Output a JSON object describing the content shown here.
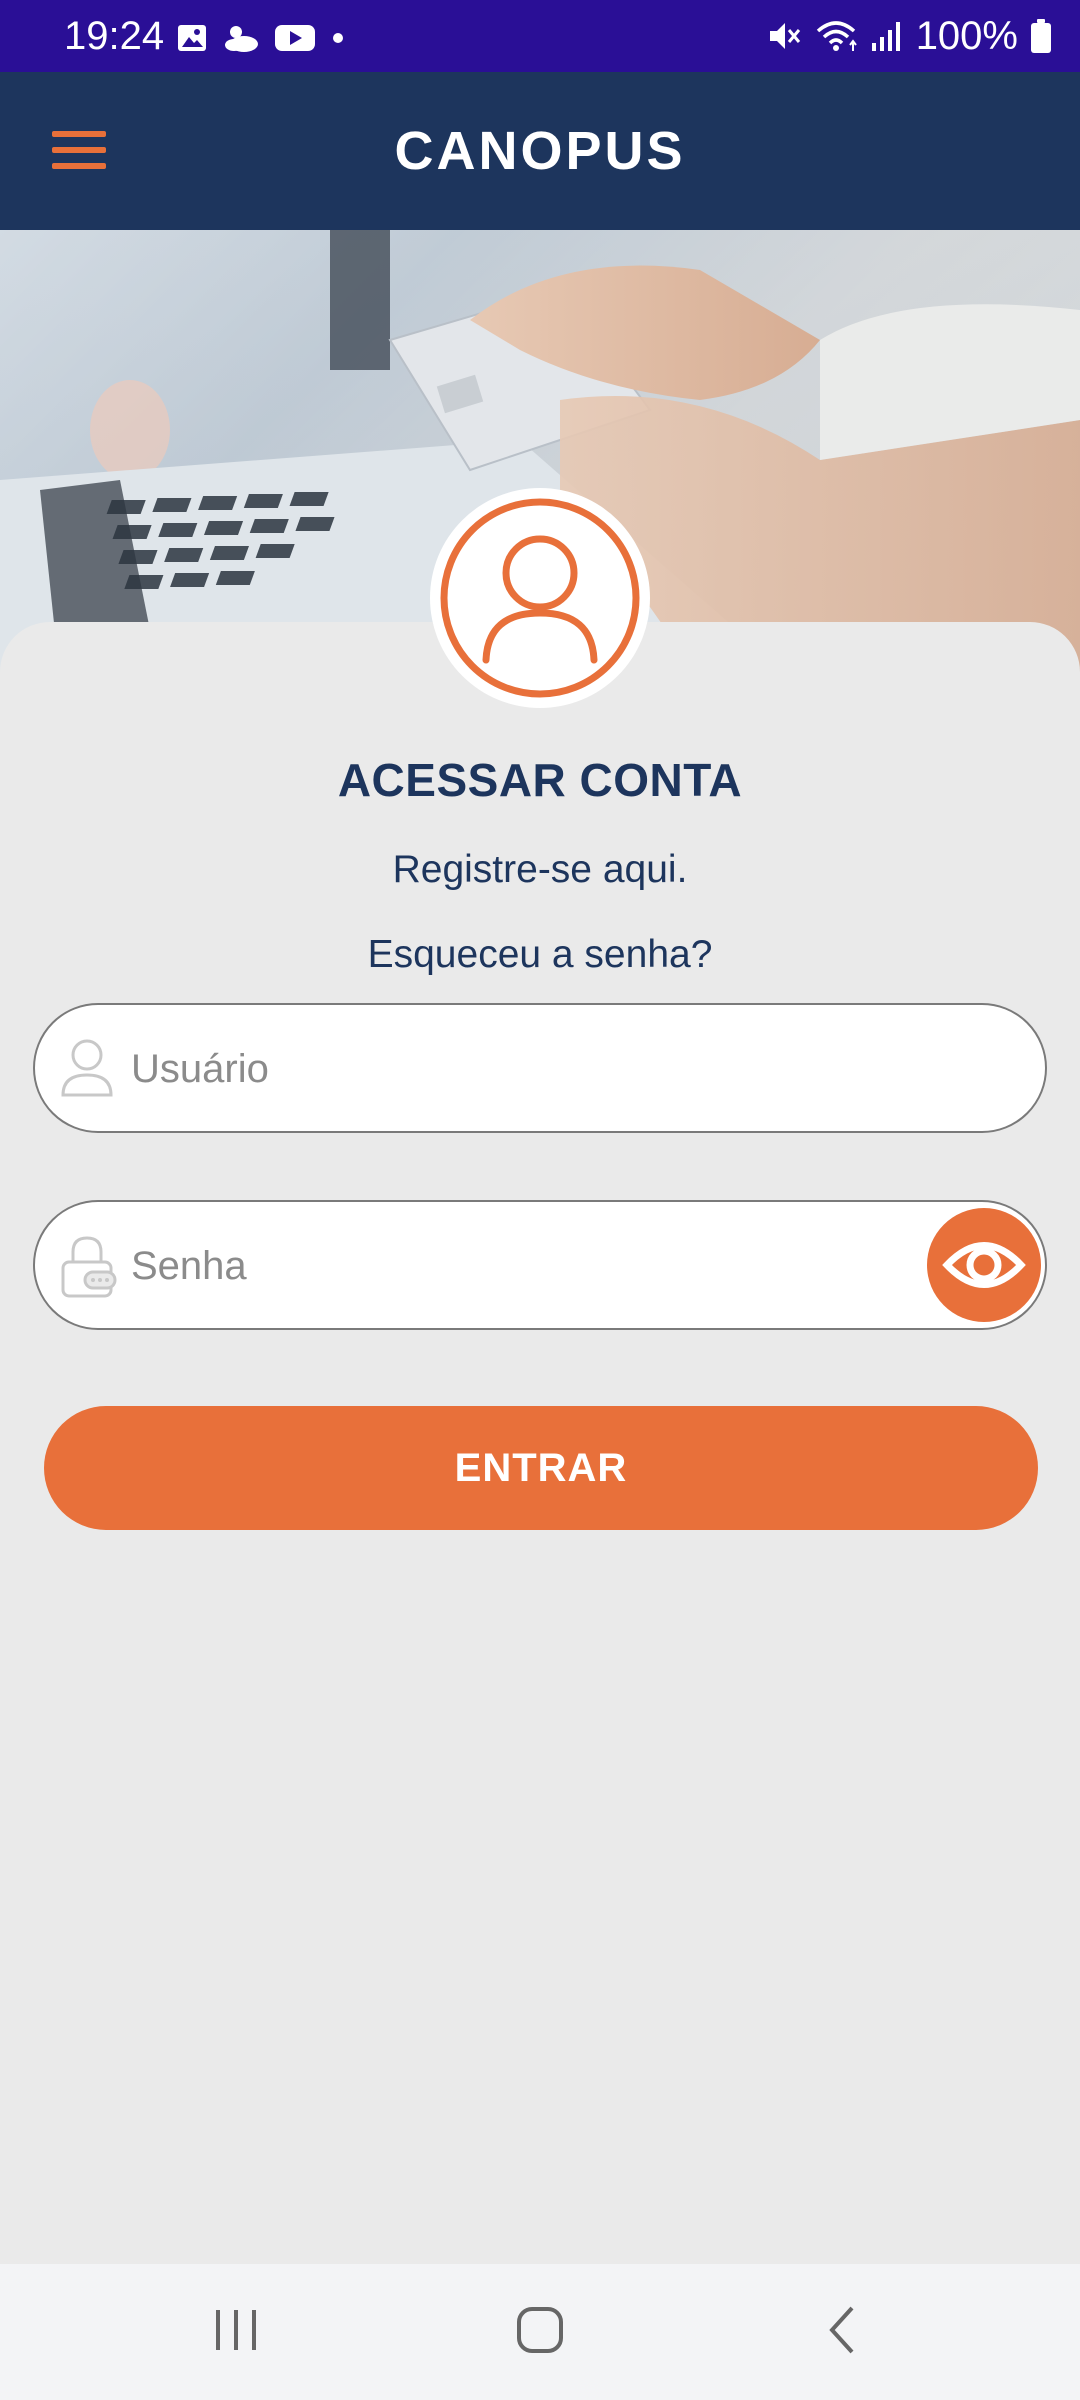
{
  "status_bar": {
    "time": "19:24",
    "battery_percent": "100%",
    "left_icons": [
      "gallery-icon",
      "weather-icon",
      "youtube-icon",
      "dot-icon"
    ],
    "right_icons": [
      "mute-icon",
      "wifi-icon",
      "signal-icon",
      "battery-icon"
    ]
  },
  "app_bar": {
    "brand": "CANOPUS",
    "menu_icon": "hamburger-menu-icon"
  },
  "hero": {
    "image": "hand-holding-credit-card-over-laptop-keyboard"
  },
  "login": {
    "title": "ACESSAR CONTA",
    "register_link": "Registre-se aqui.",
    "forgot_link": "Esqueceu a senha?",
    "username": {
      "placeholder": "Usuário",
      "value": "",
      "icon": "user-icon"
    },
    "password": {
      "placeholder": "Senha",
      "value": "",
      "icon": "lock-icon",
      "toggle_icon": "eye-icon"
    },
    "submit_label": "ENTRAR"
  },
  "nav_bar": {
    "buttons": [
      "recent-apps-icon",
      "home-icon",
      "back-icon"
    ]
  },
  "colors": {
    "status_bar": "#2a0f96",
    "app_bar": "#1d355d",
    "accent": "#e8703a",
    "text_primary": "#1d355d",
    "background": "#eaeaea"
  }
}
